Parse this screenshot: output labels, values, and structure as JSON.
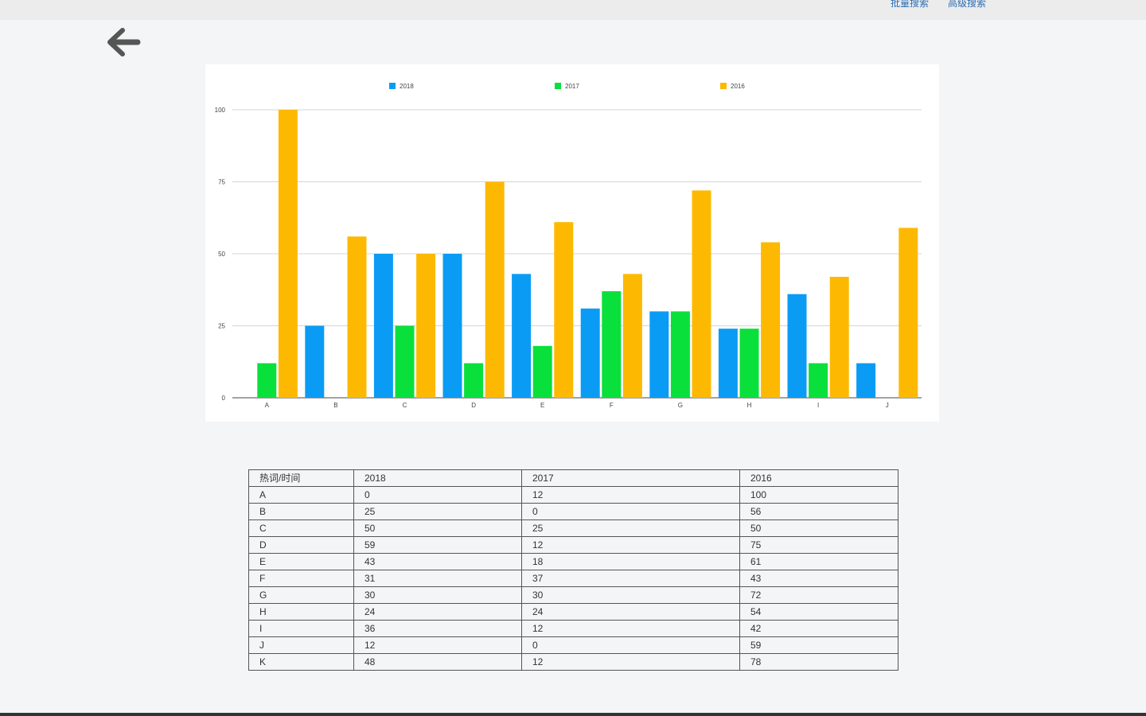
{
  "header": {
    "links": [
      "批量搜索",
      "高级搜索"
    ]
  },
  "nav": {
    "back_icon": "arrow-left-icon"
  },
  "colors": {
    "series_2018": "#0a9cf5",
    "series_2017": "#0ae03b",
    "series_2016": "#fdb902",
    "page_bg": "#f4f5f6",
    "link": "#2a6db3"
  },
  "chart_data": {
    "type": "bar",
    "categories": [
      "A",
      "B",
      "C",
      "D",
      "E",
      "F",
      "G",
      "H",
      "I",
      "J"
    ],
    "series": [
      {
        "name": "2018",
        "values": [
          0,
          25,
          50,
          50,
          43,
          31,
          30,
          24,
          36,
          12
        ]
      },
      {
        "name": "2017",
        "values": [
          12,
          0,
          25,
          12,
          18,
          37,
          30,
          24,
          12,
          0
        ]
      },
      {
        "name": "2016",
        "values": [
          100,
          56,
          50,
          75,
          61,
          43,
          72,
          54,
          42,
          59
        ]
      }
    ],
    "yticks": [
      "0",
      "25",
      "50",
      "75",
      "100"
    ],
    "ylim": [
      0,
      100
    ],
    "grid": true,
    "legend": "top-center"
  },
  "table": {
    "headers": [
      "热词/时间",
      "2018",
      "2017",
      "2016"
    ],
    "rows": [
      [
        "A",
        "0",
        "12",
        "100"
      ],
      [
        "B",
        "25",
        "0",
        "56"
      ],
      [
        "C",
        "50",
        "25",
        "50"
      ],
      [
        "D",
        "59",
        "12",
        "75"
      ],
      [
        "E",
        "43",
        "18",
        "61"
      ],
      [
        "F",
        "31",
        "37",
        "43"
      ],
      [
        "G",
        "30",
        "30",
        "72"
      ],
      [
        "H",
        "24",
        "24",
        "54"
      ],
      [
        "I",
        "36",
        "12",
        "42"
      ],
      [
        "J",
        "12",
        "0",
        "59"
      ],
      [
        "K",
        "48",
        "12",
        "78"
      ]
    ]
  }
}
